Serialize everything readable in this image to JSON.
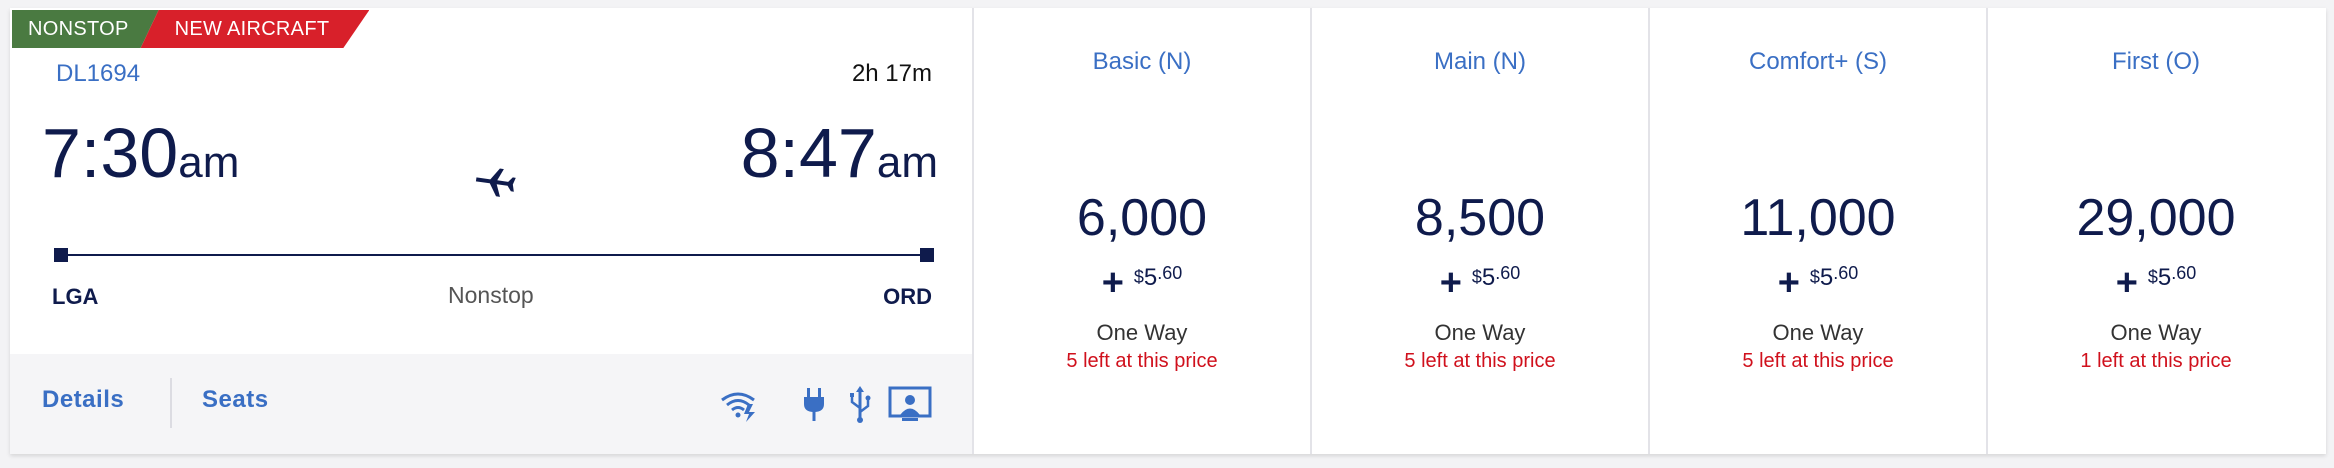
{
  "badges": {
    "nonstop": "NONSTOP",
    "new_aircraft": "NEW AIRCRAFT"
  },
  "flight": {
    "number": "DL1694",
    "duration": "2h 17m",
    "depart": {
      "time": "7:30",
      "ampm": "am",
      "airport": "LGA"
    },
    "arrive": {
      "time": "8:47",
      "ampm": "am",
      "airport": "ORD"
    },
    "stops": "Nonstop"
  },
  "footer": {
    "details": "Details",
    "seats": "Seats"
  },
  "amenities": [
    "wifi-icon",
    "power-outlet-icon",
    "usb-icon",
    "personal-screen-icon"
  ],
  "fares": [
    {
      "name": "Basic (N)",
      "miles": "6,000",
      "tax_dollar": "$",
      "tax_amount": "5",
      "tax_cents": ".60",
      "trip": "One Way",
      "availability": "5 left at this price"
    },
    {
      "name": "Main (N)",
      "miles": "8,500",
      "tax_dollar": "$",
      "tax_amount": "5",
      "tax_cents": ".60",
      "trip": "One Way",
      "availability": "5 left at this price"
    },
    {
      "name": "Comfort+ (S)",
      "miles": "11,000",
      "tax_dollar": "$",
      "tax_amount": "5",
      "tax_cents": ".60",
      "trip": "One Way",
      "availability": "5 left at this price"
    },
    {
      "name": "First (O)",
      "miles": "29,000",
      "tax_dollar": "$",
      "tax_amount": "5",
      "tax_cents": ".60",
      "trip": "One Way",
      "availability": "1 left at this price"
    }
  ],
  "colors": {
    "navy": "#0f1b4c",
    "link_blue": "#3a6fc4",
    "alert_red": "#d0101c",
    "badge_green": "#4a7a41",
    "badge_red": "#d8202a"
  }
}
